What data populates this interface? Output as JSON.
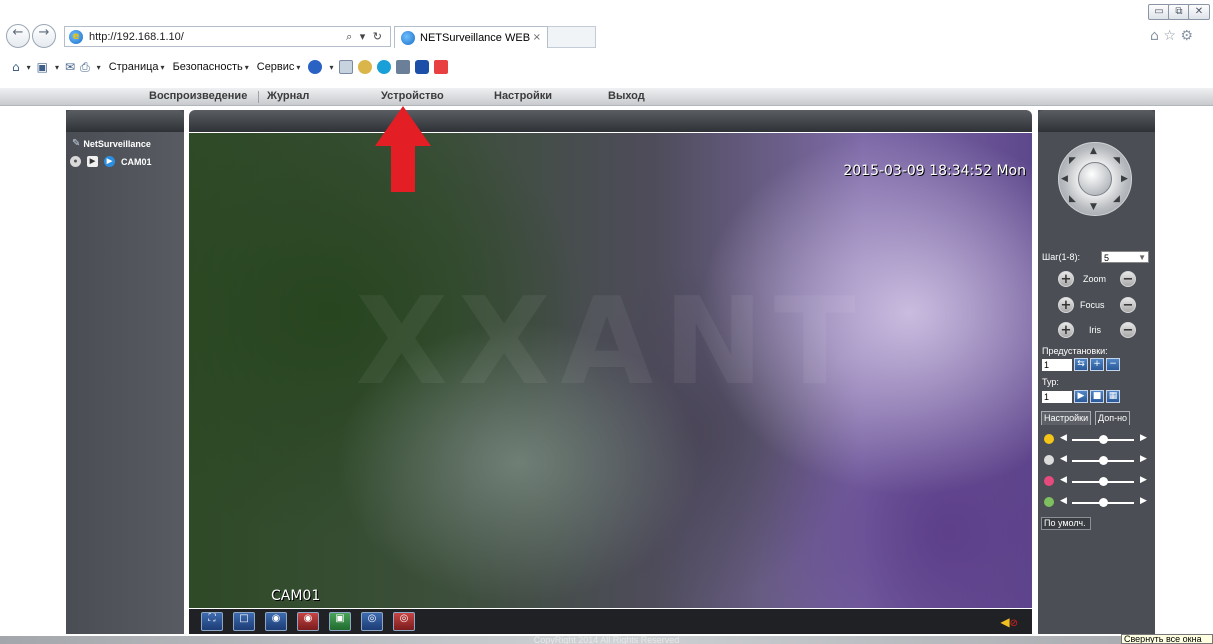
{
  "browser": {
    "url": "http://192.168.1.10/",
    "address_tools": "⌕ ▾ ↻",
    "tab_title": "NETSurveillance WEB",
    "tab_close": "×",
    "window_min": "▭",
    "window_restore": "⧉",
    "window_close": "✕",
    "top_icons": "⌂ ☆ ⚙",
    "back": "←",
    "forward": "→",
    "command_menus": [
      "Страница",
      "Безопасность",
      "Сервис"
    ],
    "dropdown_glyph": "▾"
  },
  "menu": {
    "items": [
      "Воспроизведение",
      "Журнал",
      "Устройство",
      "Настройки",
      "Выход"
    ]
  },
  "sidebar": {
    "root_label": "NetSurveillance",
    "camera_label": "CAM01"
  },
  "video": {
    "timestamp": "2015-03-09 18:34:52 Mon",
    "camera_name": "CAM01",
    "watermark": "XXANT"
  },
  "ptz": {
    "step_label": "Шаг(1-8):",
    "step_value": "5",
    "zoom_label": "Zoom",
    "focus_label": "Focus",
    "iris_label": "Iris",
    "presets_label": "Предустановки:",
    "preset_value": "1",
    "tour_label": "Тур:",
    "tour_value": "1"
  },
  "image_tabs": {
    "tab1": "Настройки",
    "tab2": "Доп-но"
  },
  "image_sliders": [
    {
      "name": "brightness",
      "value": 0.5,
      "color": "#f5c518"
    },
    {
      "name": "contrast",
      "value": 0.5,
      "color": "#dcdcdc"
    },
    {
      "name": "saturation",
      "value": 0.5,
      "color": "#e94a7d"
    },
    {
      "name": "hue",
      "value": 0.5,
      "color": "#7fbf5f"
    }
  ],
  "default_button": "По умолч.",
  "footer": {
    "copyright": "CopyRight 2014 All Rights Reserved",
    "tooltip": "Свернуть все окна"
  },
  "colors": {
    "panel": "#4b4f55",
    "accent_arrow": "#e31e24"
  }
}
